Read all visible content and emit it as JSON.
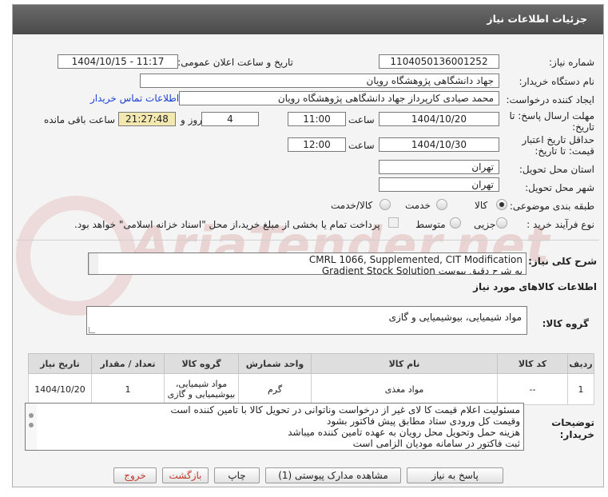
{
  "header": {
    "title": "جزئیات اطلاعات نیاز"
  },
  "fields": {
    "need_number_label": "شماره نیاز:",
    "need_number": "1104050136001252",
    "announce_label": "تاریخ و ساعت اعلان عمومی:",
    "announce_value": "1404/10/15 - 11:17",
    "buyer_org_label": "نام دستگاه خریدار:",
    "buyer_org": "جهاد دانشگاهی پژوهشگاه رویان",
    "creator_label": "ایجاد کننده درخواست:",
    "creator": "محمد صیادی کارپرداز جهاد دانشگاهی پژوهشگاه رویان",
    "contact_link": "اطلاعات تماس خریدار",
    "deadline_label_1": "مهلت ارسال پاسخ: تا",
    "deadline_label_2": "تاریخ:",
    "deadline_date": "1404/10/20",
    "time_label": "ساعت",
    "deadline_time": "11:00",
    "day_label": "روز و",
    "days": "4",
    "remaining_time": "21:27:48",
    "remaining_label": "ساعت باقی مانده",
    "validity_label_1": "حداقل تاریخ اعتبار",
    "validity_label_2": "قیمت: تا تاریخ:",
    "validity_date": "1404/10/30",
    "validity_time": "12:00",
    "province_label": "استان محل تحویل:",
    "province": "تهران",
    "city_label": "شهر محل تحویل:",
    "city": "تهران",
    "category_label": "طبقه بندی موضوعی:",
    "category_options": [
      "کالا",
      "خدمت",
      "کالا/خدمت"
    ],
    "category_selected": "کالا",
    "process_label": "نوع فرآیند خرید :",
    "process_options": [
      "جزیی",
      "متوسط"
    ],
    "process_note": "پرداخت تمام یا بخشی از مبلغ خرید،از محل \"اسناد خزانه اسلامی\" خواهد بود."
  },
  "description": {
    "label": "شرح کلی نیاز:",
    "line1": "CMRL 1066, Supplemented, CIT Modification",
    "line2": "Gradient Stock Solution  به شرح دقیق پیوست"
  },
  "goods": {
    "section_title": "اطلاعات کالاهای مورد نیاز",
    "group_label": "گروه کالا:",
    "group_value": "مواد شیمیایی، بیوشیمیایی و  گازی",
    "columns": [
      "ردیف",
      "کد کالا",
      "نام کالا",
      "واحد شمارش",
      "گروه کالا",
      "تعداد / مقدار",
      "تاریخ نیاز"
    ],
    "rows": [
      {
        "row": "1",
        "code": "--",
        "name": "مواد مغذی",
        "unit": "گرم",
        "group": "مواد شیمیایی، بیوشیمیایی و گازی",
        "qty": "1",
        "date": "1404/10/20"
      }
    ]
  },
  "buyer_notes": {
    "label_1": "توضیحات",
    "label_2": "خریدار:",
    "lines": [
      "مسئولیت اعلام قیمت کا لای  غیر از درخواست وناتوانی در تحویل کالا با تامین کننده است",
      "وقیمت کل ورودی ستاد مطابق پیش فاکتور بشود",
      "هزینه حمل وتحویل محل رویان به عهده تامین کننده میباشد",
      "ثبت فاکتور در سامانه مودیان الزامی است"
    ]
  },
  "buttons": {
    "reply": "پاسخ به نیاز",
    "view_docs": "مشاهده مدارک پیوستی (1)",
    "print": "چاپ",
    "back": "بازگشت",
    "exit": "خروج"
  },
  "watermark": "AriaTender.net",
  "colors": {
    "title_bar": "#555555",
    "link": "#1a3fd6",
    "remaining_bg": "#f3e9b0",
    "watermark": "#c84848"
  }
}
